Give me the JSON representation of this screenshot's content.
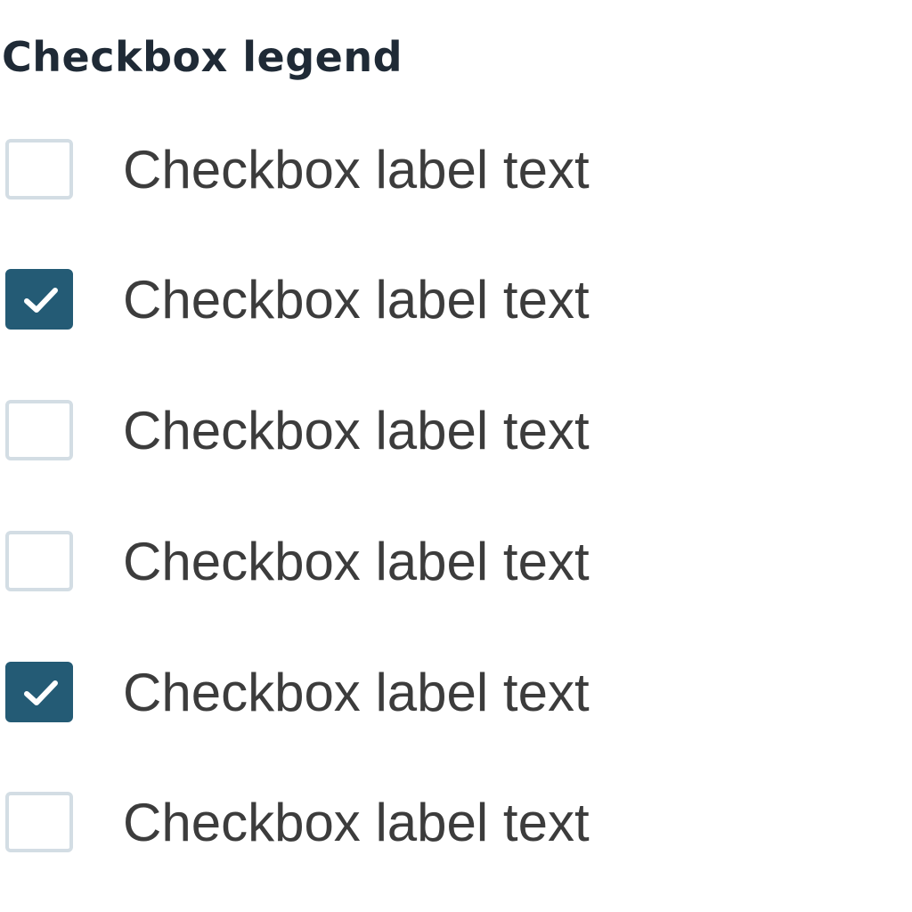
{
  "legend": "Checkbox legend",
  "colors": {
    "checked_fill": "#245b75",
    "unchecked_border": "#d3dde4",
    "label_text": "#3c3c3c",
    "legend_text": "#1f2a36"
  },
  "options": [
    {
      "label": "Checkbox label text",
      "checked": false
    },
    {
      "label": "Checkbox label text",
      "checked": true
    },
    {
      "label": "Checkbox label text",
      "checked": false
    },
    {
      "label": "Checkbox label text",
      "checked": false
    },
    {
      "label": "Checkbox label text",
      "checked": true
    },
    {
      "label": "Checkbox label text",
      "checked": false
    }
  ]
}
